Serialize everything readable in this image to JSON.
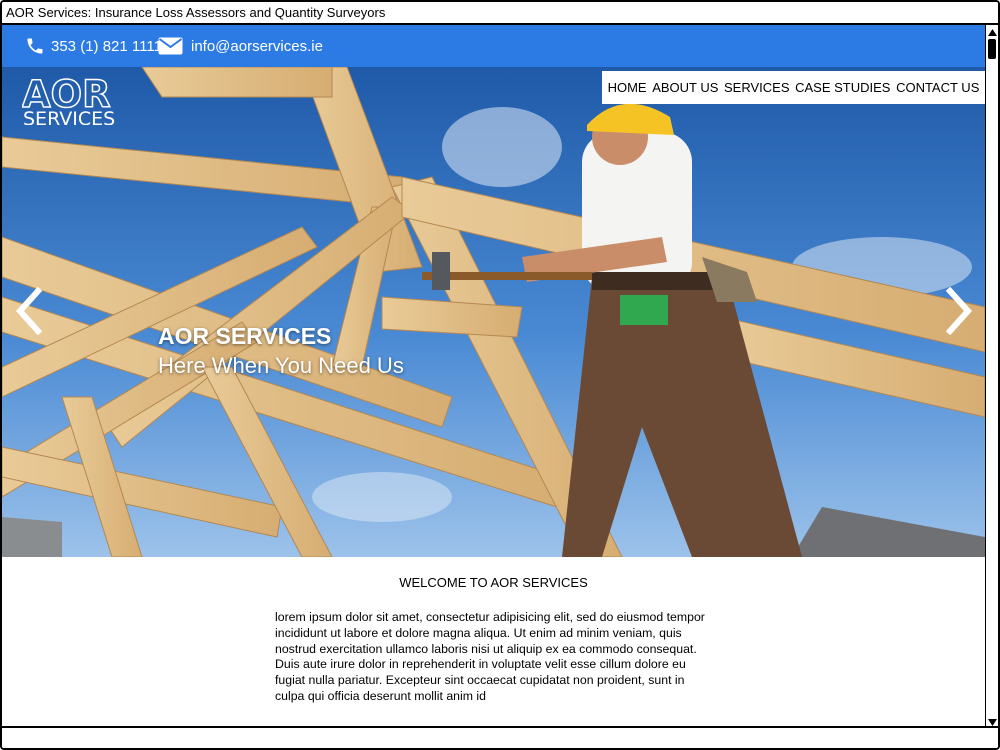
{
  "window": {
    "title": "AOR Services: Insurance Loss Assessors and Quantity Surveyors"
  },
  "contact": {
    "phone": "353 (1) 821 1111",
    "email": "info@aorservices.ie"
  },
  "logo": {
    "line1": "AOR",
    "line2": "SERVICES"
  },
  "nav": [
    "HOME",
    "ABOUT US",
    "SERVICES",
    "CASE STUDIES",
    "CONTACT US"
  ],
  "hero": {
    "title": "AOR SERVICES",
    "subtitle": "Here When You Need Us"
  },
  "content": {
    "heading": "WELCOME TO AOR SERVICES",
    "paragraph": "lorem ipsum dolor sit amet, consectetur adipisicing elit, sed do eiusmod tempor incididunt ut labore et dolore magna aliqua. Ut enim ad minim veniam, quis nostrud exercitation ullamco laboris nisi ut aliquip ex ea commodo consequat. Duis aute irure dolor in reprehenderit in voluptate velit esse cillum dolore eu fugiat nulla pariatur. Excepteur sint occaecat cupidatat non proident, sunt in culpa qui officia deserunt mollit anim id"
  },
  "icons": {
    "phone": "phone-icon",
    "email": "envelope-icon",
    "prev": "chevron-left-icon",
    "next": "chevron-right-icon"
  },
  "colors": {
    "topbar": "#2c7be5",
    "sky": "#2f6fbf",
    "timber": "#e3c28f"
  }
}
